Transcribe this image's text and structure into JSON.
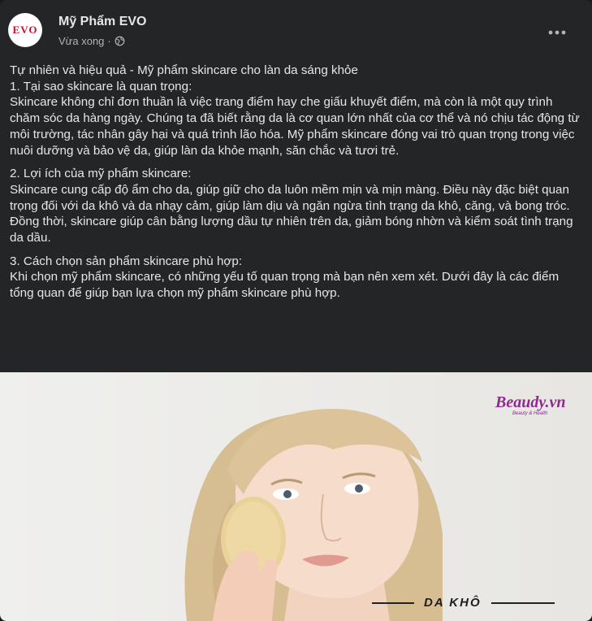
{
  "header": {
    "page_name": "Mỹ Phẩm EVO",
    "avatar_text": "EVO",
    "time": "Vừa xong",
    "separator": "·"
  },
  "post": {
    "paragraphs": [
      "Tự nhiên và hiệu quả - Mỹ phẩm skincare cho làn da sáng khỏe",
      "1. Tại sao skincare là quan trọng:",
      "Skincare không chỉ đơn thuần là việc trang điểm hay che giấu khuyết điểm, mà còn là một quy trình chăm sóc da hàng ngày. Chúng ta đã biết rằng da là cơ quan lớn nhất của cơ thể và nó chịu tác động từ môi trường, tác nhân gây hại và quá trình lão hóa. Mỹ phẩm skincare đóng vai trò quan trọng trong việc nuôi dưỡng và bảo vệ da, giúp làn da khỏe mạnh, săn chắc và tươi trẻ.",
      "2. Lợi ích của mỹ phẩm skincare:",
      "Skincare cung cấp độ ẩm cho da, giúp giữ cho da luôn mềm mịn và mịn màng. Điều này đặc biệt quan trọng đối với da khô và da nhạy cảm, giúp làm dịu và ngăn ngừa tình trạng da khô, căng, và bong tróc. Đồng thời, skincare giúp cân bằng lượng dầu tự nhiên trên da, giảm bóng nhờn và kiểm soát tình trạng da dầu.",
      "3. Cách chọn sản phẩm skincare phù hợp:",
      "Khi chọn mỹ phẩm skincare, có những yếu tố quan trọng mà bạn nên xem xét. Dưới đây là các điểm tổng quan để giúp bạn lựa chọn mỹ phẩm skincare phù hợp."
    ]
  },
  "image": {
    "brand": "Beaudy.vn",
    "brand_tagline": "Beauty & Health",
    "caption": "DA KHÔ"
  },
  "colors": {
    "card_bg": "#242526",
    "text_primary": "#e4e6eb",
    "text_secondary": "#b0b3b8",
    "brand_purple": "#8e2b8f"
  },
  "icons": {
    "privacy": "globe-icon",
    "menu": "more-horizontal-icon"
  }
}
